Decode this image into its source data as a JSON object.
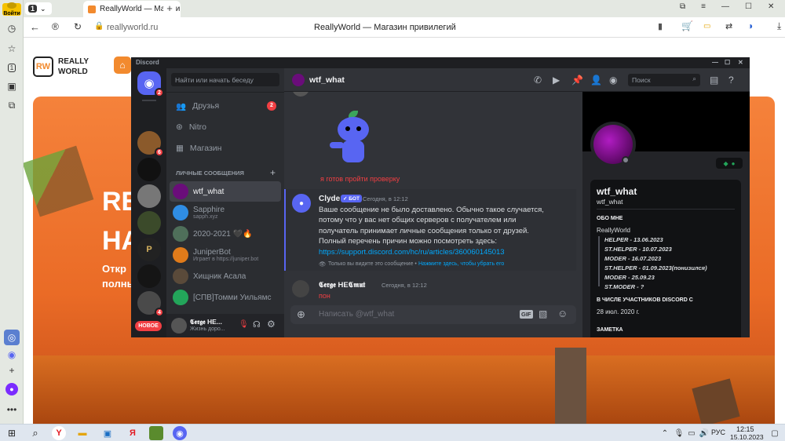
{
  "browser": {
    "sidebar_badge": "Войти",
    "tab_count": "1",
    "tab_title": "ReallyWorld — Магазин",
    "page_title": "ReallyWorld — Магазин привилегий",
    "url": "reallyworld.ru"
  },
  "site": {
    "logo_line1": "REALLY",
    "logo_line2": "WORLD",
    "hero_big1": "RE",
    "hero_big2": "НА",
    "hero_small1": "Откр",
    "hero_small2": "полны"
  },
  "discord": {
    "app_title": "Discord",
    "home_badge": "2",
    "servers": [
      {
        "name": "server-1",
        "badge": "6"
      },
      {
        "name": "server-2",
        "badge": ""
      },
      {
        "name": "server-3",
        "badge": ""
      },
      {
        "name": "server-4",
        "badge": ""
      },
      {
        "name": "server-5",
        "badge": ""
      },
      {
        "name": "server-6",
        "badge": ""
      },
      {
        "name": "server-7",
        "badge": "4"
      }
    ],
    "new_button": "НОВОЕ",
    "search_placeholder": "Найти или начать беседу",
    "nav": {
      "friends": "Друзья",
      "friends_badge": "2",
      "nitro": "Nitro",
      "shop": "Магазин"
    },
    "dm_header": "ЛИЧНЫЕ СООБЩЕНИЯ",
    "dms": [
      {
        "name": "wtf_what",
        "sub": ""
      },
      {
        "name": "Sapphire",
        "sub": "sapph.xyz"
      },
      {
        "name": "2020-2021 🖤🔥",
        "sub": ""
      },
      {
        "name": "JuniperBot",
        "sub": "Играет в https://juniper.bot"
      },
      {
        "name": "Хищник Асала",
        "sub": ""
      },
      {
        "name": "[СПВ]Томми Уильямс",
        "sub": ""
      }
    ],
    "user": {
      "name": "𝕮𝖊𝖗𝖌𝖊 НЕ...",
      "status": "Жизнь доро..."
    },
    "chat": {
      "channel": "wtf_what",
      "header_search": "Поиск",
      "sticker_caption": "я готов пройти проверку",
      "clyde_name": "Clyde",
      "bot_tag": "✓ БОТ",
      "clyde_time": "Сегодня, в 12:12",
      "clyde_lines": [
        "Ваше сообщение не было доставлено. Обычно такое случается,",
        "потому что у вас нет общих серверов с получателем или",
        "получатель принимает личные сообщения только от друзей.",
        "Полный перечень причин можно посмотреть здесь:"
      ],
      "clyde_link": "https://support.discord.com/hc/ru/articles/360060145013",
      "ephemeral_note": "Только вы видите это сообщение •",
      "ephemeral_link": "Нажмите здесь, чтобы убрать его",
      "user2_name": "𝕮𝖊𝖗𝖌𝖊 НЕ𝕮𝖒𝖚𝖙",
      "user2_time": "Сегодня, в 12:12",
      "user2_text": "пон",
      "input_placeholder": "Написать @wtf_what",
      "gif_label": "GIF"
    },
    "profile": {
      "display_name": "wtf_what",
      "username": "wtf_what",
      "about_title": "ОБО МНЕ",
      "about_lines": [
        "ReallyWorld",
        "HELPER - 13.06.2023",
        "ST.HELPER - 10.07.2023",
        "MODER - 16.07.2023",
        "ST.HELPER - 01.09.2023(понизился)",
        "MODER - 25.09.23",
        "ST.MODER - ?"
      ],
      "member_title": "В ЧИСЛЕ УЧАСТНИКОВ DISCORD С",
      "member_since": "28 июл. 2020 г.",
      "note_title": "ЗАМЕТКА"
    }
  },
  "taskbar": {
    "lang": "РУС",
    "time": "12:15",
    "date": "15.10.2023"
  }
}
